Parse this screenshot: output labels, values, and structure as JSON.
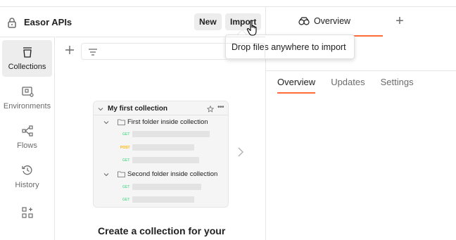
{
  "workspace": {
    "title": "Easor APIs",
    "new_label": "New",
    "import_label": "Import"
  },
  "tooltip": {
    "text": "Drop files anywhere to import"
  },
  "right_pane": {
    "tab_label": "Overview",
    "subtabs": [
      "Overview",
      "Updates",
      "Settings"
    ],
    "active_subtab": "Overview"
  },
  "sidebar": {
    "items": [
      {
        "label": "Collections",
        "icon": "collections-icon",
        "active": true
      },
      {
        "label": "Environments",
        "icon": "environments-icon",
        "active": false
      },
      {
        "label": "Flows",
        "icon": "flows-icon",
        "active": false
      },
      {
        "label": "History",
        "icon": "history-icon",
        "active": false
      }
    ]
  },
  "preview": {
    "collection_name": "My first collection",
    "folder1": "First folder inside collection",
    "folder2": "Second folder inside collection",
    "methods": [
      "GET",
      "POST",
      "GET",
      "GET",
      "GET"
    ]
  },
  "empty_state": {
    "heading": "Create a collection for your"
  },
  "colors": {
    "accent": "#ff6c37",
    "get": "#6bdd9a",
    "post": "#ffb400"
  }
}
